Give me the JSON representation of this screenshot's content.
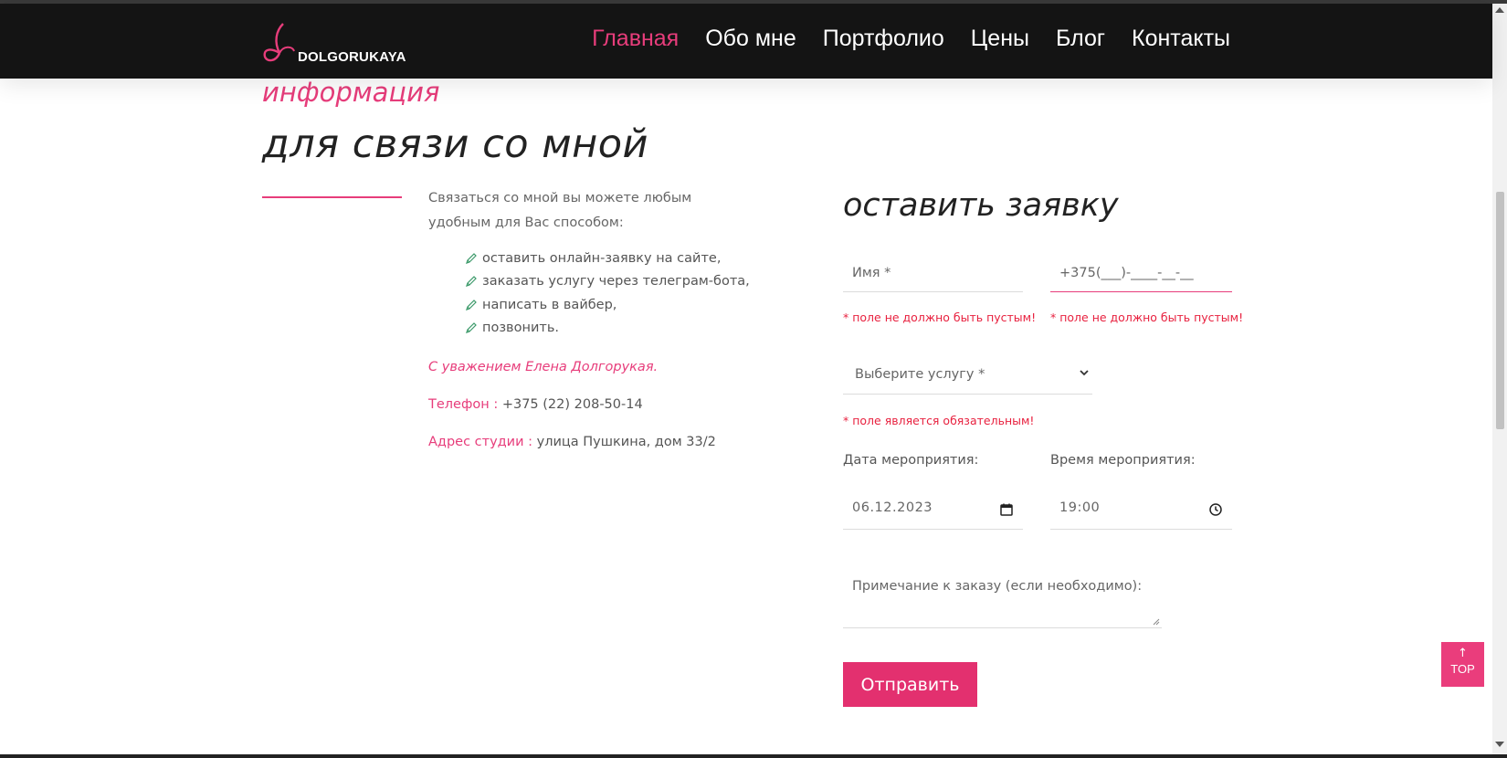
{
  "brand": {
    "logo_text": "DOLGORUKAYA",
    "accent_color": "#e73d7b"
  },
  "nav": {
    "items": [
      {
        "label": "Главная",
        "active": true
      },
      {
        "label": "Обо мне",
        "active": false
      },
      {
        "label": "Портфолио",
        "active": false
      },
      {
        "label": "Цены",
        "active": false
      },
      {
        "label": "Блог",
        "active": false
      },
      {
        "label": "Контакты",
        "active": false
      }
    ]
  },
  "section": {
    "subtitle": "информация",
    "title": "для связи со мной"
  },
  "contacts": {
    "intro": "Связаться со мной вы можете любым удобным для Вас способом:",
    "ways": [
      "оставить онлайн-заявку на сайте,",
      "заказать услугу через телеграм-бота,",
      "написать в вайбер,",
      "позвонить."
    ],
    "way_icon": "pencil-icon",
    "regards": "С уважением Елена Долгорукая.",
    "phone_label": "Телефон :",
    "phone_value": "+375 (22) 208-50-14",
    "address_label": "Адрес студии :",
    "address_value": "улица Пушкина, дом 33/2"
  },
  "form": {
    "title": "оставить заявку",
    "name_placeholder": "Имя *",
    "phone_value": "+375(___)-____-__-__",
    "name_error": "* поле не должно быть пустым!",
    "phone_error": "* поле не должно быть пустым!",
    "service_placeholder": "Выберите услугу *",
    "service_error": "* поле является обязательным!",
    "date_label": "Дата мероприятия:",
    "date_value": "06.12.2023",
    "time_label": "Время мероприятия:",
    "time_value": "19:00",
    "note_placeholder": "Примечание к заказу (если необходимо):",
    "submit_label": "Отправить"
  },
  "top_button": {
    "arrow": "↑",
    "label": "TOP"
  }
}
